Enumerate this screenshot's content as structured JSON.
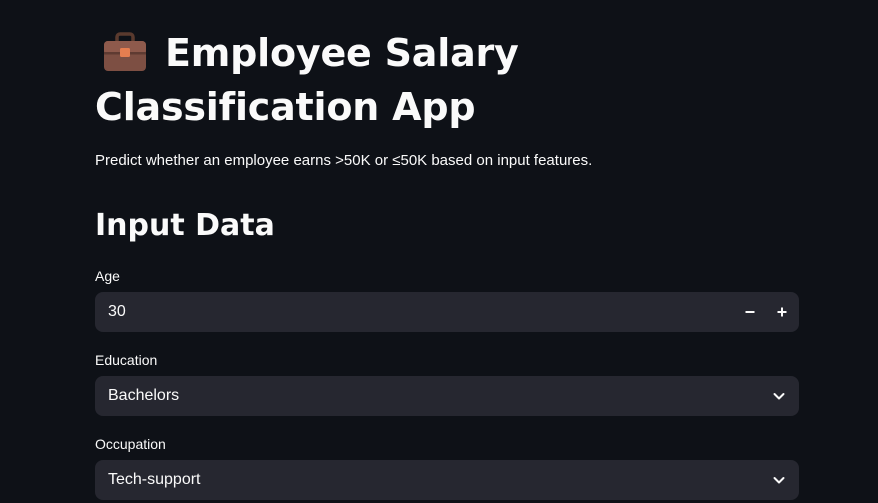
{
  "header": {
    "icon": "briefcase-icon",
    "title": "Employee Salary Classification App",
    "subtitle": "Predict whether an employee earns >50K or ≤50K based on input features."
  },
  "form": {
    "section_title": "Input Data",
    "age": {
      "label": "Age",
      "value": "30",
      "decrement_icon": "minus-icon",
      "increment_icon": "plus-icon"
    },
    "education": {
      "label": "Education",
      "value": "Bachelors",
      "icon": "chevron-down-icon"
    },
    "occupation": {
      "label": "Occupation",
      "value": "Tech-support",
      "icon": "chevron-down-icon"
    }
  },
  "colors": {
    "background": "#0e1117",
    "input_background": "#262730",
    "text": "#fafafa"
  }
}
